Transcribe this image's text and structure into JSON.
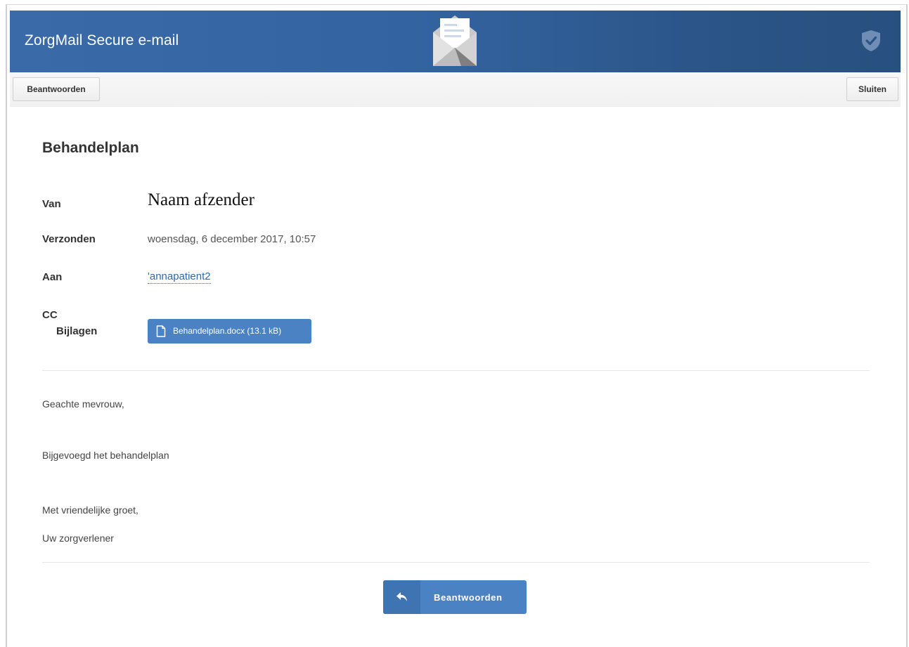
{
  "header": {
    "title": "ZorgMail Secure e-mail",
    "envelope_icon": "envelope-open-icon",
    "shield_icon": "shield-check-icon",
    "accent_color": "#3364a1"
  },
  "toolbar": {
    "reply_label": "Beantwoorden",
    "close_label": "Sluiten"
  },
  "message": {
    "subject": "Behandelplan",
    "fields": {
      "from_label": "Van",
      "from_value": "Naam afzender",
      "sent_label": "Verzonden",
      "sent_value": "woensdag, 6 december 2017, 10:57",
      "to_label": "Aan",
      "to_value": "'annapatient2",
      "cc_label": "CC",
      "attachments_label": "Bijlagen"
    },
    "attachments": [
      {
        "label": "Behandelplan.docx (13.1 kB)",
        "icon": "document-icon"
      }
    ],
    "body": {
      "greeting": "Geachte mevrouw,",
      "line1": "Bijgevoegd het behandelplan",
      "closing": "Met vriendelijke groet,",
      "signature": "Uw zorgverlener"
    }
  },
  "footer": {
    "reply_label": "Beantwoorden",
    "reply_icon": "reply-arrow-icon",
    "button_color": "#4a82c4"
  }
}
